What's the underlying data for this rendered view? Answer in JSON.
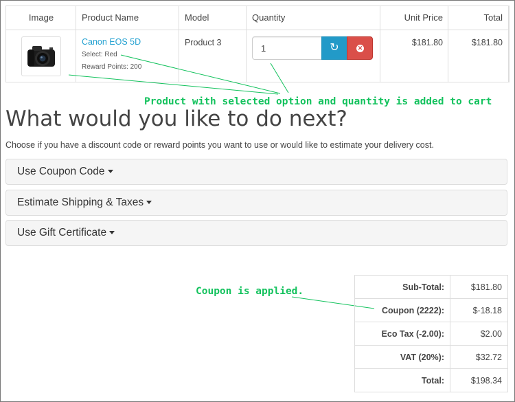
{
  "cart": {
    "headers": {
      "image": "Image",
      "name": "Product Name",
      "model": "Model",
      "quantity": "Quantity",
      "unit_price": "Unit Price",
      "total": "Total"
    },
    "item": {
      "name": "Canon EOS 5D",
      "option": "Select: Red",
      "reward": "Reward Points: 200",
      "model": "Product 3",
      "quantity": "1",
      "unit_price": "$181.80",
      "total": "$181.80"
    }
  },
  "annotations": {
    "added": "Product with selected option and quantity is added to cart",
    "coupon": "Coupon is applied."
  },
  "next": {
    "heading": "What would you like to do next?",
    "intro": "Choose if you have a discount code or reward points you want to use or would like to estimate your delivery cost.",
    "panels": [
      {
        "label": "Use Coupon Code"
      },
      {
        "label": "Estimate Shipping & Taxes"
      },
      {
        "label": "Use Gift Certificate"
      }
    ]
  },
  "totals": [
    {
      "label": "Sub-Total:",
      "value": "$181.80"
    },
    {
      "label": "Coupon (2222):",
      "value": "$-18.18"
    },
    {
      "label": "Eco Tax (-2.00):",
      "value": "$2.00"
    },
    {
      "label": "VAT (20%):",
      "value": "$32.72"
    },
    {
      "label": "Total:",
      "value": "$198.34"
    }
  ],
  "icons": {
    "update": "refresh-icon",
    "remove": "remove-icon",
    "product": "camera-icon",
    "dropdown": "caret-down-icon"
  },
  "colors": {
    "link": "#23a1d1",
    "annotation": "#13c25d",
    "update_button": "#229ac8",
    "remove_button": "#da4f49"
  }
}
